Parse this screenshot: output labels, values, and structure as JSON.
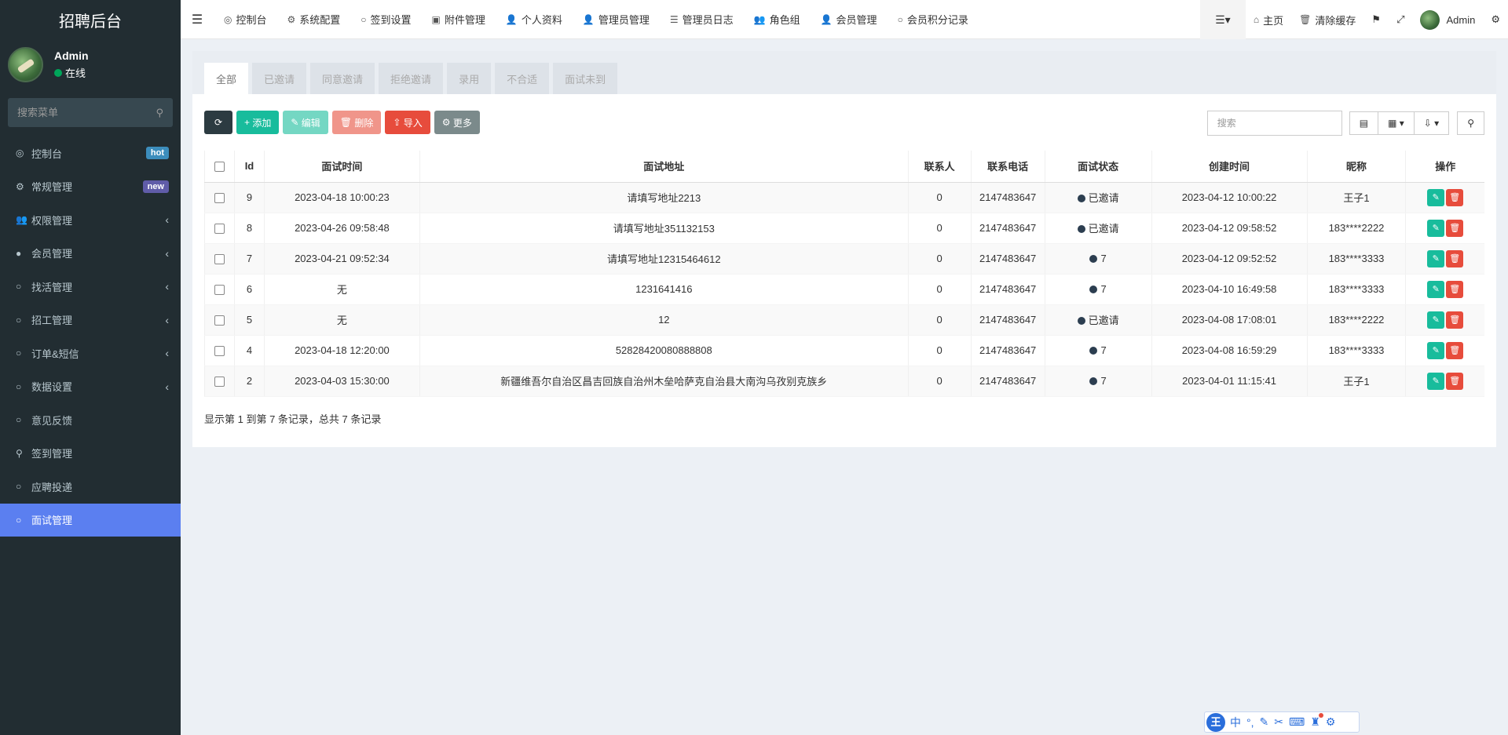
{
  "app": {
    "title": "招聘后台"
  },
  "user": {
    "name": "Admin",
    "status": "在线"
  },
  "sidebar": {
    "search_placeholder": "搜索菜单",
    "items": [
      {
        "label": "控制台",
        "icon": "dashboard-icon",
        "glyph": "◎",
        "badge": "hot"
      },
      {
        "label": "常规管理",
        "icon": "cogs-icon",
        "glyph": "⚙",
        "badge": "new"
      },
      {
        "label": "权限管理",
        "icon": "group-icon",
        "glyph": "👥",
        "expand": "‹"
      },
      {
        "label": "会员管理",
        "icon": "user-circle-icon",
        "glyph": "●",
        "expand": "‹"
      },
      {
        "label": "找活管理",
        "icon": "circle-icon",
        "glyph": "○",
        "expand": "‹"
      },
      {
        "label": "招工管理",
        "icon": "circle-icon",
        "glyph": "○",
        "expand": "‹"
      },
      {
        "label": "订单&短信",
        "icon": "circle-icon",
        "glyph": "○",
        "expand": "‹"
      },
      {
        "label": "数据设置",
        "icon": "circle-icon",
        "glyph": "○",
        "expand": "‹"
      },
      {
        "label": "意见反馈",
        "icon": "circle-icon",
        "glyph": "○"
      },
      {
        "label": "签到管理",
        "icon": "map-marker-icon",
        "glyph": "⚲"
      },
      {
        "label": "应聘投递",
        "icon": "circle-icon",
        "glyph": "○"
      },
      {
        "label": "面试管理",
        "icon": "circle-icon",
        "glyph": "○",
        "active": true
      }
    ]
  },
  "topnav": {
    "tabs": [
      {
        "label": "控制台",
        "icon": "dashboard-icon",
        "glyph": "◎"
      },
      {
        "label": "系统配置",
        "icon": "gear-icon",
        "glyph": "⚙"
      },
      {
        "label": "签到设置",
        "icon": "circle-icon",
        "glyph": "○"
      },
      {
        "label": "附件管理",
        "icon": "image-icon",
        "glyph": "▣"
      },
      {
        "label": "个人资料",
        "icon": "user-icon",
        "glyph": "👤"
      },
      {
        "label": "管理员管理",
        "icon": "user-icon",
        "glyph": "👤"
      },
      {
        "label": "管理员日志",
        "icon": "list-alt-icon",
        "glyph": "☰"
      },
      {
        "label": "角色组",
        "icon": "group-icon",
        "glyph": "👥"
      },
      {
        "label": "会员管理",
        "icon": "user-icon",
        "glyph": "👤"
      },
      {
        "label": "会员积分记录",
        "icon": "circle-icon",
        "glyph": "○"
      }
    ],
    "home": "主页",
    "clear_cache": "清除缓存",
    "admin": "Admin"
  },
  "status_tabs": [
    "全部",
    "已邀请",
    "同意邀请",
    "拒绝邀请",
    "录用",
    "不合适",
    "面试未到"
  ],
  "toolbar": {
    "refresh": "⟳",
    "add": "添加",
    "edit": "编辑",
    "delete": "删除",
    "import": "导入",
    "more": "更多",
    "search_placeholder": "搜索"
  },
  "table": {
    "columns": [
      "Id",
      "面试时间",
      "面试地址",
      "联系人",
      "联系电话",
      "面试状态",
      "创建时间",
      "昵称",
      "操作"
    ],
    "rows": [
      {
        "id": "9",
        "time": "2023-04-18 10:00:23",
        "address": "请填写地址2213",
        "contact": "0",
        "phone": "2147483647",
        "state": "已邀请",
        "created": "2023-04-12 10:00:22",
        "nickname": "王子1"
      },
      {
        "id": "8",
        "time": "2023-04-26 09:58:48",
        "address": "请填写地址351132153",
        "contact": "0",
        "phone": "2147483647",
        "state": "已邀请",
        "created": "2023-04-12 09:58:52",
        "nickname": "183****2222"
      },
      {
        "id": "7",
        "time": "2023-04-21 09:52:34",
        "address": "请填写地址12315464612",
        "contact": "0",
        "phone": "2147483647",
        "state": "7",
        "created": "2023-04-12 09:52:52",
        "nickname": "183****3333"
      },
      {
        "id": "6",
        "time": "无",
        "address": "1231641416",
        "contact": "0",
        "phone": "2147483647",
        "state": "7",
        "created": "2023-04-10 16:49:58",
        "nickname": "183****3333"
      },
      {
        "id": "5",
        "time": "无",
        "address": "12",
        "contact": "0",
        "phone": "2147483647",
        "state": "已邀请",
        "created": "2023-04-08 17:08:01",
        "nickname": "183****2222"
      },
      {
        "id": "4",
        "time": "2023-04-18 12:20:00",
        "address": "52828420080888808",
        "contact": "0",
        "phone": "2147483647",
        "state": "7",
        "created": "2023-04-08 16:59:29",
        "nickname": "183****3333"
      },
      {
        "id": "2",
        "time": "2023-04-03 15:30:00",
        "address": "新疆维吾尔自治区昌吉回族自治州木垒哈萨克自治县大南沟乌孜别克族乡",
        "contact": "0",
        "phone": "2147483647",
        "state": "7",
        "created": "2023-04-01 11:15:41",
        "nickname": "王子1"
      }
    ]
  },
  "pagination": {
    "info": "显示第 1 到第 7 条记录，总共 7 条记录"
  },
  "ime": {
    "logo": "王",
    "mode": "中"
  },
  "colors": {
    "sidebar_bg": "#222d32",
    "active": "#5b7ff0",
    "green": "#18bc9c",
    "red": "#e74c3c"
  }
}
